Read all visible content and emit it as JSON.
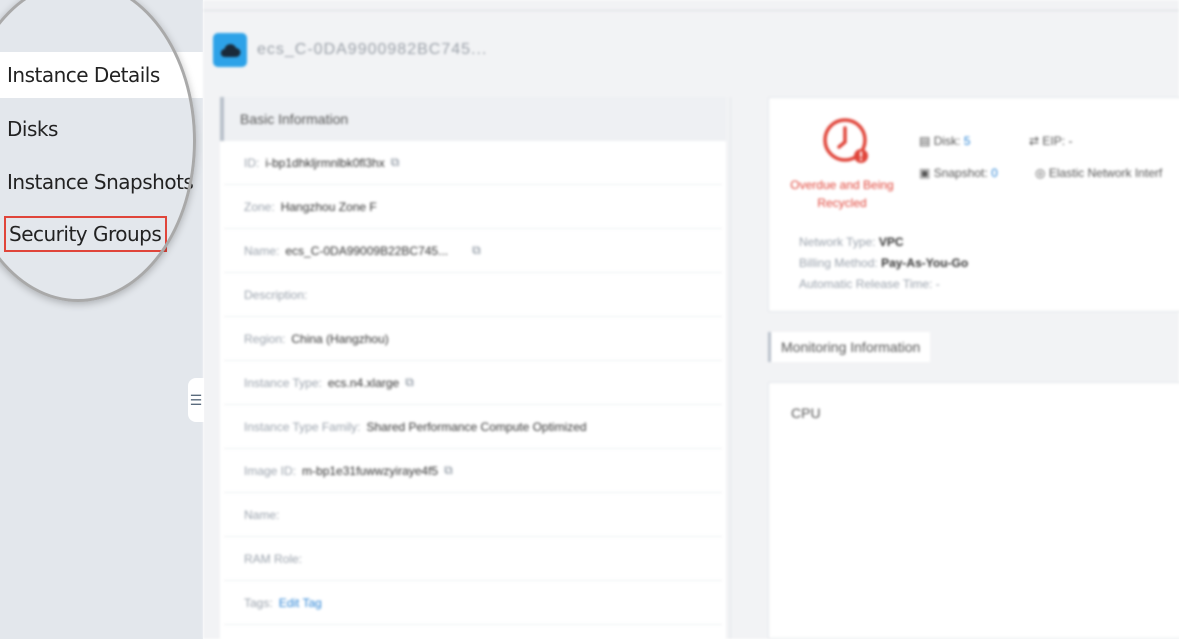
{
  "sidebar": {
    "items": [
      {
        "label": "Instance Details"
      },
      {
        "label": "Disks"
      },
      {
        "label": "Instance Snapshots"
      },
      {
        "label": "Security Groups"
      }
    ],
    "active_index": 0,
    "highlighted_index": 3
  },
  "header": {
    "instance_title": "ecs_C-0DA9900982BC745..."
  },
  "basic_info": {
    "title": "Basic Information",
    "fields": [
      {
        "label": "ID:",
        "value": "i-bp1dhkljrmnlbk0fl3hx"
      },
      {
        "label": "Zone:",
        "value": "Hangzhou Zone F"
      },
      {
        "label": "Name:",
        "value": "ecs_C-0DA99009B22BC745..."
      },
      {
        "label": "Description:",
        "value": ""
      },
      {
        "label": "Region:",
        "value": "China (Hangzhou)"
      },
      {
        "label": "Instance Type:",
        "value": "ecs.n4.xlarge"
      },
      {
        "label": "Instance Type Family:",
        "value": "Shared Performance Compute Optimized"
      },
      {
        "label": "Image ID:",
        "value": "m-bp1e31fuwwzyiraye4f5"
      },
      {
        "label": "Name:",
        "value": ""
      },
      {
        "label": "RAM Role:",
        "value": ""
      },
      {
        "label": "Tags:",
        "value": "Edit Tag"
      }
    ]
  },
  "status": {
    "text_line1": "Overdue and Being",
    "text_line2": "Recycled",
    "disk_label": "Disk:",
    "disk_count": "5",
    "snapshot_label": "Snapshot:",
    "snapshot_count": "0",
    "eip_label": "EIP:",
    "eip_value": "-",
    "eni_label": "Elastic Network Interf"
  },
  "network": {
    "type_label": "Network Type:",
    "type_value": "VPC",
    "billing_label": "Billing Method:",
    "billing_value": "Pay-As-You-Go",
    "release_label": "Automatic Release Time:",
    "release_value": "-"
  },
  "monitoring": {
    "title": "Monitoring Information",
    "cpu_label": "CPU"
  },
  "colors": {
    "accent": "#2da2e8",
    "alert": "#e0453a",
    "link": "#2e86d6"
  }
}
